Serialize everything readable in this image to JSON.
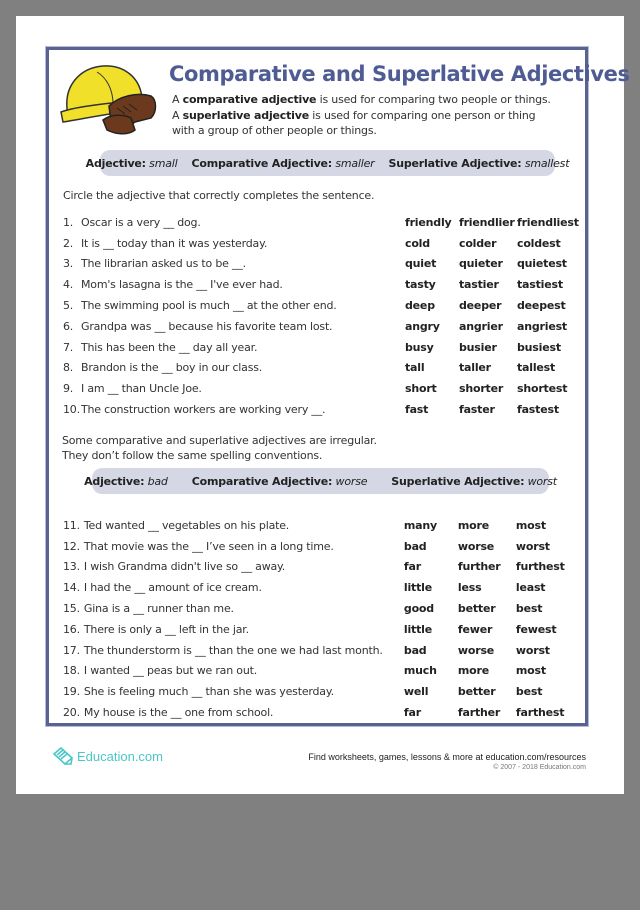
{
  "header": {
    "title": "Comparative and Superlative Adjectives",
    "intro": {
      "line1_pre": "A ",
      "line1_term": "comparative adjective",
      "line1_post": " is used for comparing two people or things.",
      "line2_pre": "A ",
      "line2_term": "superlative adjective",
      "line2_post": " is used for comparing one person or thing",
      "line3": "with a group of other people or things."
    }
  },
  "example1": {
    "adj_label": "Adjective:",
    "adj_value": "small",
    "comp_label": "Comparative Adjective:",
    "comp_value": "smaller",
    "sup_label": "Superlative Adjective:",
    "sup_value": "smallest"
  },
  "instruction": "Circle the adjective that correctly completes the sentence.",
  "section1": [
    {
      "num": "1.",
      "text": "Oscar is a very __ dog.",
      "choices": [
        "friendly",
        "friendlier",
        "friendliest"
      ]
    },
    {
      "num": "2.",
      "text": "It is __ today than it was yesterday.",
      "choices": [
        "cold",
        "colder",
        "coldest"
      ]
    },
    {
      "num": "3.",
      "text": "The librarian asked us to be __.",
      "choices": [
        "quiet",
        "quieter",
        "quietest"
      ]
    },
    {
      "num": "4.",
      "text": "Mom's lasagna is the __ I've ever had.",
      "choices": [
        "tasty",
        "tastier",
        "tastiest"
      ]
    },
    {
      "num": "5.",
      "text": "The swimming pool is much __ at the other end.",
      "choices": [
        "deep",
        "deeper",
        "deepest"
      ]
    },
    {
      "num": "6.",
      "text": "Grandpa was __ because his favorite team lost.",
      "choices": [
        "angry",
        "angrier",
        "angriest"
      ]
    },
    {
      "num": "7.",
      "text": "This has been the __ day all year.",
      "choices": [
        "busy",
        "busier",
        "busiest"
      ]
    },
    {
      "num": "8.",
      "text": "Brandon is the __ boy in our class.",
      "choices": [
        "tall",
        "taller",
        "tallest"
      ]
    },
    {
      "num": "9.",
      "text": "I am __ than Uncle Joe.",
      "choices": [
        "short",
        "shorter",
        "shortest"
      ]
    },
    {
      "num": "10.",
      "text": "The construction workers are working very __.",
      "choices": [
        "fast",
        "faster",
        "fastest"
      ]
    }
  ],
  "irregular_note": {
    "line1": "Some comparative and superlative adjectives are irregular.",
    "line2": "They don’t follow the same spelling conventions."
  },
  "example2": {
    "adj_label": "Adjective:",
    "adj_value": "bad",
    "comp_label": "Comparative Adjective:",
    "comp_value": "worse",
    "sup_label": "Superlative Adjective:",
    "sup_value": "worst"
  },
  "section2": [
    {
      "num": "11.",
      "text": "Ted wanted __ vegetables on his plate.",
      "choices": [
        "many",
        "more",
        "most"
      ]
    },
    {
      "num": "12.",
      "text": "That movie was the __ I’ve seen in a long time.",
      "choices": [
        "bad",
        "worse",
        "worst"
      ]
    },
    {
      "num": "13.",
      "text": "I wish Grandma didn't live so __ away.",
      "choices": [
        "far",
        "further",
        "furthest"
      ]
    },
    {
      "num": "14.",
      "text": "I had the __ amount of ice cream.",
      "choices": [
        "little",
        "less",
        "least"
      ]
    },
    {
      "num": "15.",
      "text": "Gina is a __ runner than me.",
      "choices": [
        "good",
        "better",
        "best"
      ]
    },
    {
      "num": "16.",
      "text": "There is only a __ left in the jar.",
      "choices": [
        "little",
        "fewer",
        "fewest"
      ]
    },
    {
      "num": "17.",
      "text": "The thunderstorm is  __ than the one we had last month.",
      "choices": [
        "bad",
        "worse",
        "worst"
      ]
    },
    {
      "num": "18.",
      "text": "I wanted __ peas but we ran out.",
      "choices": [
        "much",
        "more",
        "most"
      ]
    },
    {
      "num": "19.",
      "text": "She is feeling much __ than she was yesterday.",
      "choices": [
        "well",
        "better",
        "best"
      ]
    },
    {
      "num": "20.",
      "text": "My house is the __ one from school.",
      "choices": [
        "far",
        "farther",
        "farthest"
      ]
    }
  ],
  "footer": {
    "logo_text": "Education.com",
    "logo_icon": "pencil-paper-icon",
    "find_text": "Find worksheets, games, lessons & more at education.com/resources",
    "copyright": "© 2007 - 2018 Education.com"
  },
  "colors": {
    "title": "#4f5b93",
    "frame": "#5a6291",
    "pill": "#d5d7e4",
    "logo": "#4cc7c7",
    "background": "#808080"
  }
}
